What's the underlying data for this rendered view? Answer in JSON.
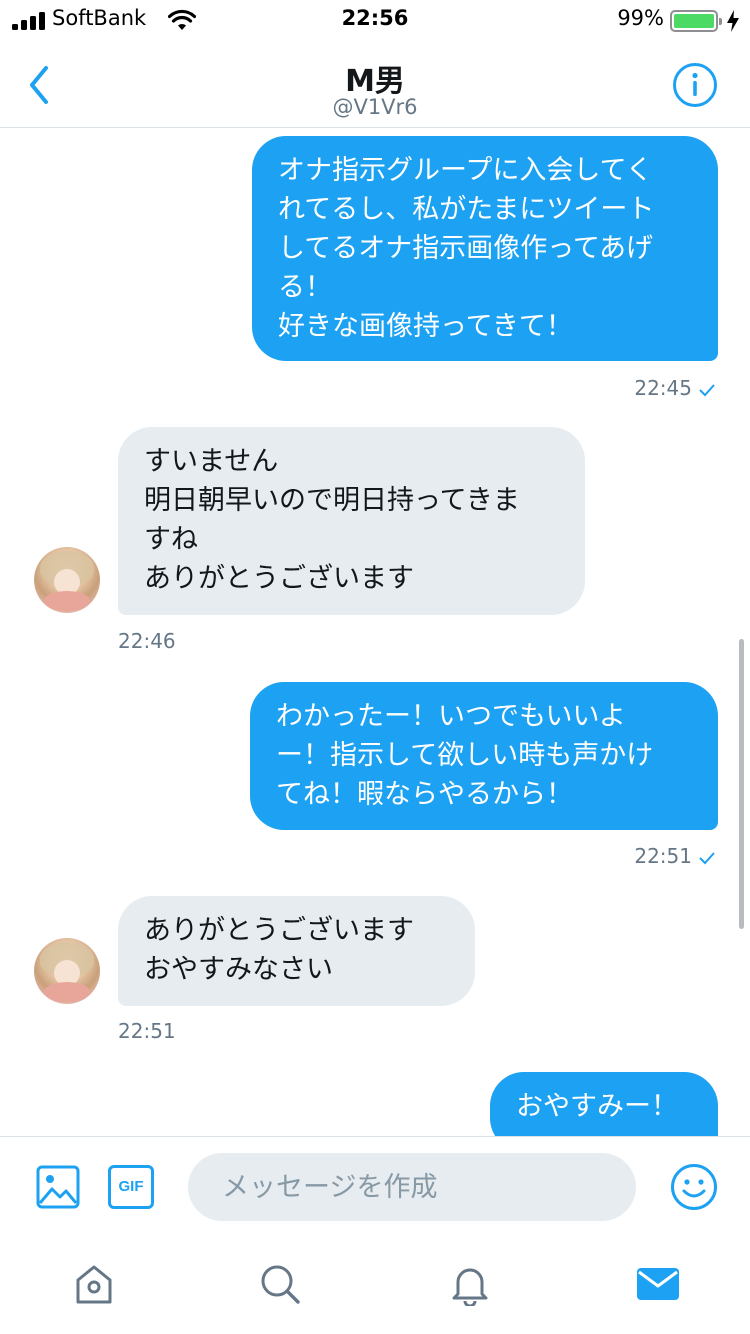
{
  "status_bar": {
    "carrier": "SoftBank",
    "time": "22:56",
    "battery_percent": "99%",
    "battery_level": 0.99,
    "battery_color": "#4cd964"
  },
  "header": {
    "back_icon": "chevron-left-icon",
    "title": "M男",
    "handle": "@V1Vr6",
    "info_icon": "info-icon"
  },
  "messages": [
    {
      "direction": "sent",
      "text": "オナ指示グループに入会してく\nれてるし、私がたまにツイート\nしてるオナ指示画像作ってあげ\nる！\n好きな画像持ってきて！",
      "time": "22:45",
      "read": true
    },
    {
      "direction": "received",
      "text": "すいません\n明日朝早いので明日持ってきま\nすね\nありがとうございます",
      "time": "22:46"
    },
    {
      "direction": "sent",
      "text": "わかったー！いつでもいいよ\nー！指示して欲しい時も声かけ\nてね！暇ならやるから！",
      "time": "22:51",
      "read": true
    },
    {
      "direction": "received",
      "text": "ありがとうございます\nおやすみなさい",
      "time": "22:51"
    },
    {
      "direction": "sent",
      "text": "おやすみー！"
    }
  ],
  "composer": {
    "media_icon": "image-icon",
    "gif_label": "GIF",
    "placeholder": "メッセージを作成",
    "emoji_icon": "smiley-icon"
  },
  "tab_bar": {
    "items": [
      "home-icon",
      "search-icon",
      "bell-icon",
      "mail-icon"
    ],
    "active": "mail-icon"
  },
  "colors": {
    "accent": "#1da1f2",
    "received_bubble": "#e6ecf0",
    "secondary_text": "#657786",
    "tab_inactive": "#657786"
  }
}
